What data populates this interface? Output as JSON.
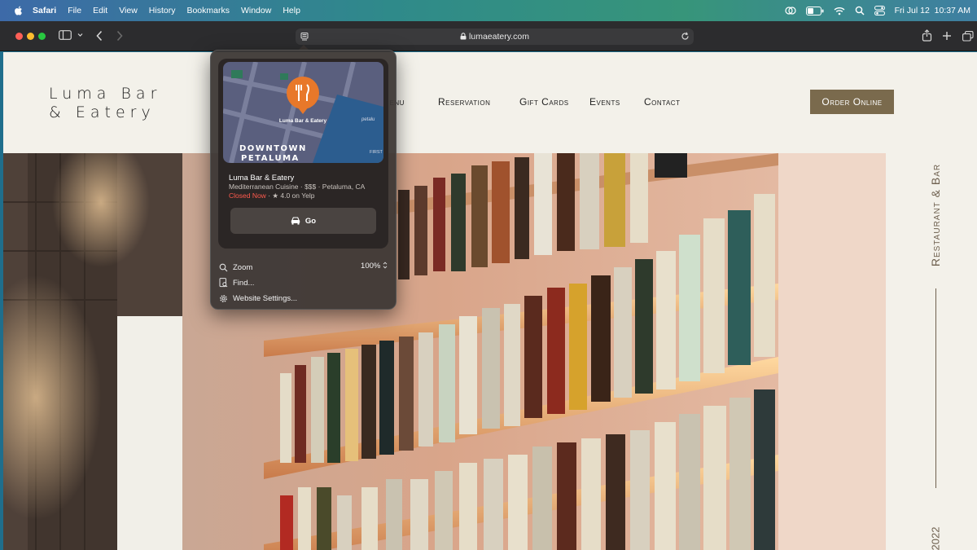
{
  "menubar": {
    "app": "Safari",
    "items": [
      "File",
      "Edit",
      "View",
      "History",
      "Bookmarks",
      "Window",
      "Help"
    ],
    "datetime": "Fri Jul 12  10:37 AM"
  },
  "toolbar": {
    "url": "lumaeatery.com"
  },
  "site": {
    "logo_line1": "Luma Bar",
    "logo_line2": "& Eatery",
    "nav": [
      "Menu",
      "Reservation",
      "Gift Cards",
      "Events",
      "Contact"
    ],
    "order_button": "Order Online",
    "side_label": "Restaurant & Bar",
    "side_year": "2022"
  },
  "popover": {
    "map_label": "Luma Bar & Eatery",
    "map_district_line1": "DOWNTOWN",
    "map_district_line2": "PETALUMA",
    "map_street_1": "petalu",
    "map_street_2": "FIRST",
    "name": "Luma Bar & Eatery",
    "subtitle": "Mediterranean Cuisine · $$$ · Petaluma, CA",
    "status_closed": "Closed Now",
    "rating_text": "· ★ 4.0 on Yelp",
    "go_label": "Go",
    "zoom_label": "Zoom",
    "zoom_value": "100%",
    "find_label": "Find...",
    "settings_label": "Website Settings..."
  },
  "colors": {
    "accent_brown": "#7a6a4d",
    "closed_red": "#ff5a4d",
    "map_pin": "#e8782a"
  }
}
